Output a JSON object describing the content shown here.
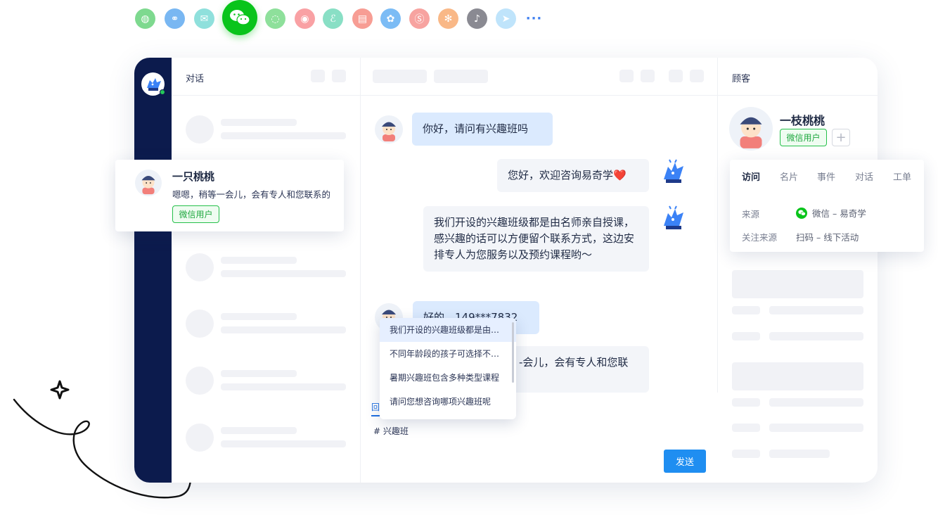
{
  "channels": [
    {
      "name": "web",
      "color": "#7ed98f",
      "glyph": "◍"
    },
    {
      "name": "link",
      "color": "#79b7f2",
      "glyph": "⚭"
    },
    {
      "name": "mail",
      "color": "#8fe0dc",
      "glyph": "✉"
    },
    {
      "name": "wechat",
      "color": "#09c41b",
      "glyph": "",
      "big": true
    },
    {
      "name": "messenger",
      "color": "#8ee09b",
      "glyph": "◌"
    },
    {
      "name": "weibo",
      "color": "#f9a1a4",
      "glyph": "◉"
    },
    {
      "name": "miniprogram",
      "color": "#89dfc5",
      "glyph": "ℰ"
    },
    {
      "name": "toutiao",
      "color": "#f79d94",
      "glyph": "▤"
    },
    {
      "name": "baidu",
      "color": "#7cbcf5",
      "glyph": "✿"
    },
    {
      "name": "sohu",
      "color": "#f7a3a0",
      "glyph": "Ⓢ"
    },
    {
      "name": "app",
      "color": "#f9b887",
      "glyph": "✻"
    },
    {
      "name": "tiktok",
      "color": "#8a8a92",
      "glyph": "♪"
    },
    {
      "name": "send",
      "color": "#bfe4fb",
      "glyph": "➤"
    },
    {
      "name": "more",
      "color": "",
      "glyph": "···"
    }
  ],
  "list_panel": {
    "title": "对话"
  },
  "customer_panel": {
    "title": "顾客"
  },
  "conversation_card": {
    "name": "一只桃桃",
    "message": "嗯嗯，稍等一会儿，会有专人和您联系的",
    "tag": "微信用户"
  },
  "messages": [
    {
      "side": "in",
      "text": "你好，请问有兴趣班吗"
    },
    {
      "side": "out",
      "text": "您好，欢迎咨询易奇学❤️"
    },
    {
      "side": "out",
      "text": "我们开设的兴趣班级都是由名师亲自授课，感兴趣的话可以方便留个联系方式，这边安排专人为您服务以及预约课程哟～"
    },
    {
      "side": "in",
      "text": "好的，149***7832"
    },
    {
      "side": "out",
      "text": "-会儿，会有专人和您联"
    }
  ],
  "composer": {
    "reply_label": "回",
    "input_text": "# 兴趣班",
    "send_label": "发送"
  },
  "suggestions": [
    "我们开设的兴趣班级都是由名师亲自授课",
    "不同年龄段的孩子可选择不同的兴趣班",
    "暑期兴趣班包含多种类型课程",
    "请问您想咨询哪项兴趣班呢"
  ],
  "customer": {
    "name": "一枝桃桃",
    "tag": "微信用户",
    "add_label": "+",
    "tabs": [
      "访问",
      "名片",
      "事件",
      "对话",
      "工单"
    ],
    "active_tab": "访问",
    "source_label": "来源",
    "source_value": "微信 – 易奇学",
    "follow_label": "关注来源",
    "follow_value": "扫码 – 线下活动"
  },
  "colors": {
    "brand_green": "#09c41b",
    "rail": "#0c1b4d",
    "send": "#1f8ef1",
    "bubble_in": "#dbeafe"
  }
}
